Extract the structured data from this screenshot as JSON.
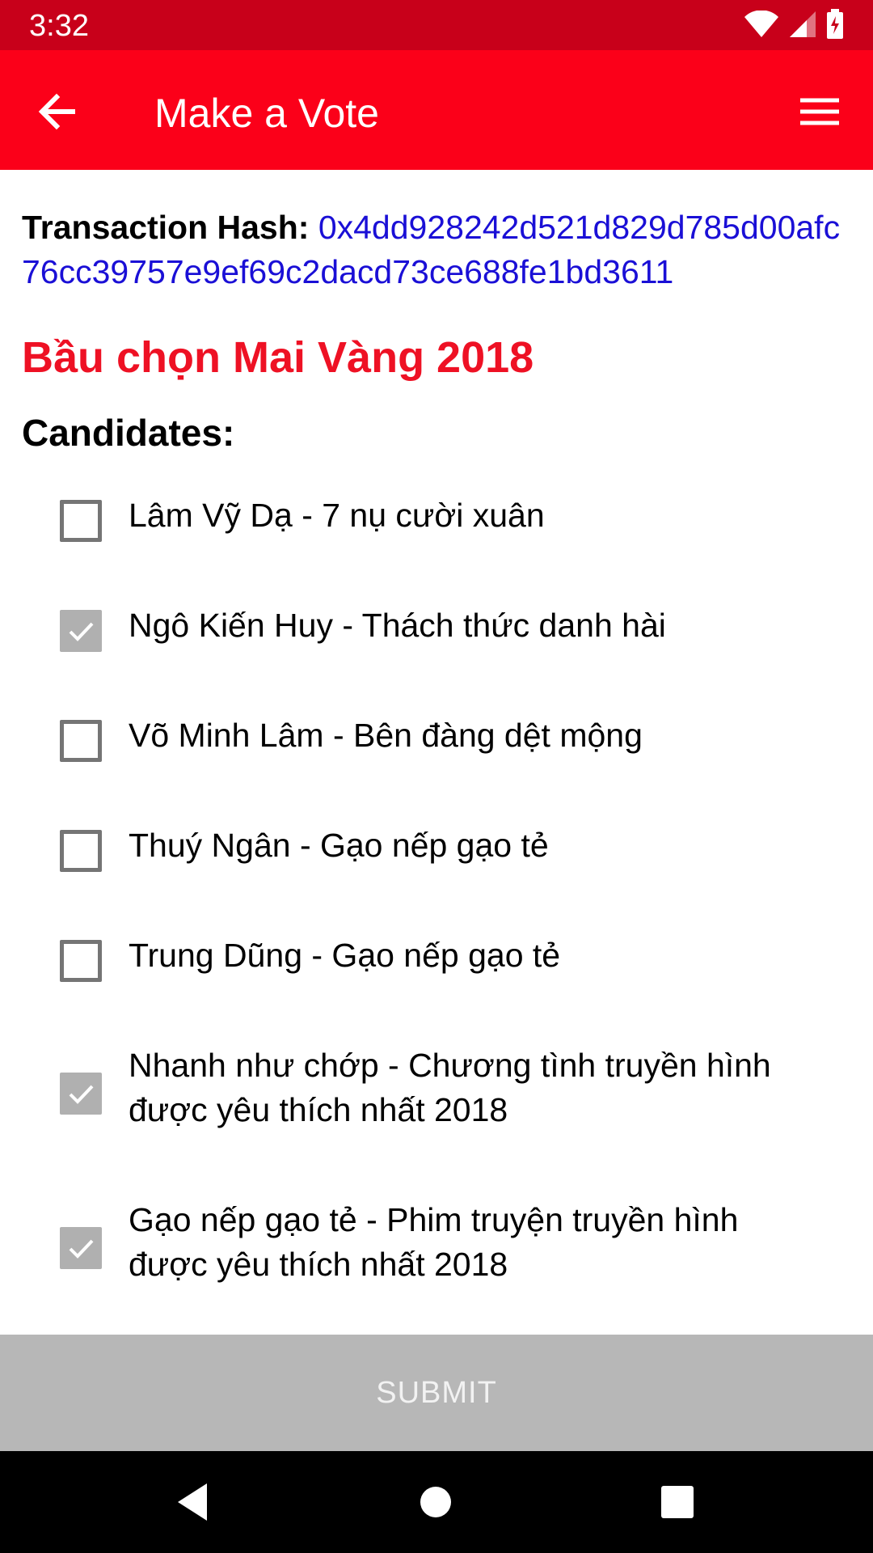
{
  "status_bar": {
    "time": "3:32",
    "icons": [
      "wifi-icon",
      "signal-icon",
      "battery-charging-icon"
    ]
  },
  "app_bar": {
    "title": "Make a Vote",
    "back_icon": "arrow-left-icon",
    "menu_icon": "hamburger-menu-icon",
    "color": "#fb0019"
  },
  "transaction": {
    "label": "Transaction Hash: ",
    "hash": "0x4dd928242d521d829d785d00afc76cc39757e9ef69c2dacd73ce688fe1bd3611"
  },
  "poll": {
    "title": "Bầu chọn Mai Vàng 2018",
    "candidates_heading": "Candidates:",
    "candidates": [
      {
        "label": "Lâm Vỹ Dạ - 7 nụ cười xuân",
        "checked": false
      },
      {
        "label": "Ngô Kiến Huy - Thách thức danh hài",
        "checked": true
      },
      {
        "label": "Võ Minh Lâm - Bên đàng dệt mộng",
        "checked": false
      },
      {
        "label": "Thuý Ngân - Gạo nếp gạo tẻ",
        "checked": false
      },
      {
        "label": "Trung Dũng - Gạo nếp gạo tẻ",
        "checked": false
      },
      {
        "label": "Nhanh như chớp - Chương tình truyền hình được yêu thích nhất 2018",
        "checked": true
      },
      {
        "label": "Gạo nếp gạo tẻ - Phim truyện truyền hình được yêu thích nhất 2018",
        "checked": true
      }
    ]
  },
  "submit": {
    "label": "SUBMIT"
  },
  "nav_bar": {
    "icons": [
      "back-triangle-icon",
      "home-circle-icon",
      "recents-square-icon"
    ]
  }
}
